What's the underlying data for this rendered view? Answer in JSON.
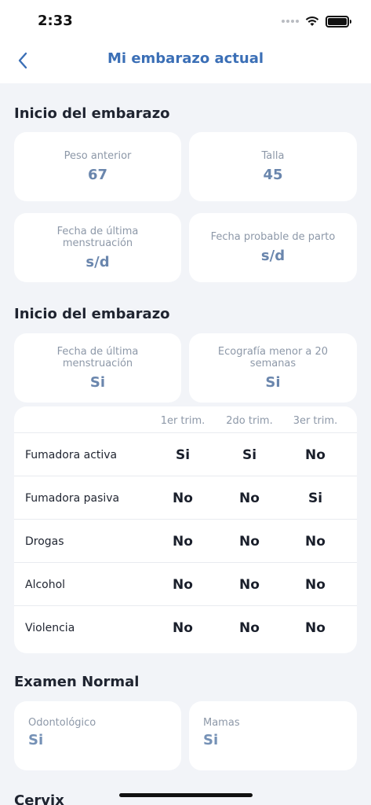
{
  "status": {
    "time": "2:33"
  },
  "nav": {
    "title": "Mi embarazo actual"
  },
  "section1": {
    "title": "Inicio del embarazo",
    "cards": [
      {
        "label": "Peso anterior",
        "value": "67"
      },
      {
        "label": "Talla",
        "value": "45"
      },
      {
        "label": "Fecha de última menstruación",
        "value": "s/d"
      },
      {
        "label": "Fecha probable de parto",
        "value": "s/d"
      }
    ]
  },
  "section2": {
    "title": "Inicio del embarazo",
    "cards": [
      {
        "label": "Fecha de última menstruación",
        "value": "Si"
      },
      {
        "label": "Ecografía menor a 20 semanas",
        "value": "Si"
      }
    ],
    "table": {
      "headers": [
        "1er trim.",
        "2do trim.",
        "3er trim."
      ],
      "rows": [
        {
          "name": "Fumadora activa",
          "values": [
            "Si",
            "Si",
            "No"
          ]
        },
        {
          "name": "Fumadora pasiva",
          "values": [
            "No",
            "No",
            "Si"
          ]
        },
        {
          "name": "Drogas",
          "values": [
            "No",
            "No",
            "No"
          ]
        },
        {
          "name": "Alcohol",
          "values": [
            "No",
            "No",
            "No"
          ]
        },
        {
          "name": "Violencia",
          "values": [
            "No",
            "No",
            "No"
          ]
        }
      ]
    }
  },
  "section3": {
    "title": "Examen Normal",
    "cards": [
      {
        "label": "Odontológico",
        "value": "Si"
      },
      {
        "label": "Mamas",
        "value": "Si"
      }
    ]
  },
  "section4": {
    "title": "Cervix"
  }
}
